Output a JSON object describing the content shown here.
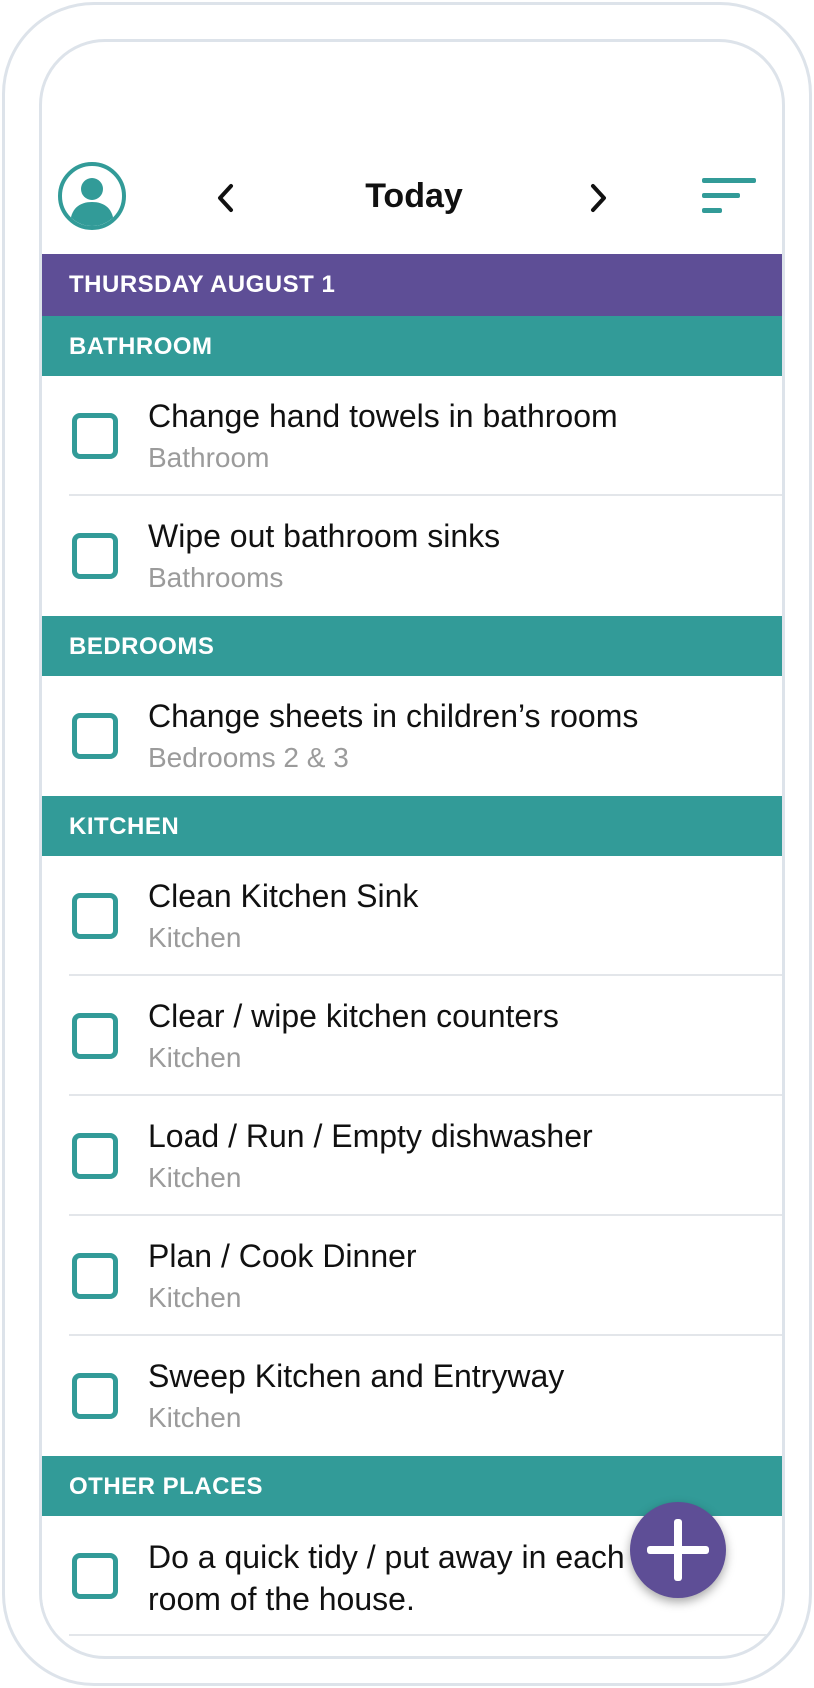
{
  "header": {
    "title": "Today",
    "prev_icon": "chevron-left-icon",
    "next_icon": "chevron-right-icon",
    "sort_icon": "sort-lines-icon",
    "avatar_icon": "user-avatar-icon"
  },
  "list": {
    "date": "THURSDAY AUGUST 1",
    "sections": [
      {
        "name": "BATHROOM",
        "tasks": [
          {
            "title": "Change hand towels in bathroom",
            "location": "Bathroom"
          },
          {
            "title": "Wipe out bathroom sinks",
            "location": "Bathrooms"
          }
        ]
      },
      {
        "name": "BEDROOMS",
        "tasks": [
          {
            "title": "Change sheets in children’s rooms",
            "location": "Bedrooms 2 & 3"
          }
        ]
      },
      {
        "name": "KITCHEN",
        "tasks": [
          {
            "title": "Clean Kitchen Sink",
            "location": "Kitchen"
          },
          {
            "title": "Clear / wipe kitchen counters",
            "location": "Kitchen"
          },
          {
            "title": "Load / Run / Empty dishwasher",
            "location": "Kitchen"
          },
          {
            "title": "Plan / Cook Dinner",
            "location": "Kitchen"
          },
          {
            "title": "Sweep Kitchen and Entryway",
            "location": "Kitchen"
          }
        ]
      },
      {
        "name": "OTHER PLACES",
        "tasks": [
          {
            "title": "Do a quick tidy / put away in each room of the house.",
            "location": ""
          }
        ]
      }
    ]
  },
  "fab": {
    "icon": "plus-icon"
  },
  "colors": {
    "accent": "#329b98",
    "date_header": "#5e4e96",
    "fab": "#5e4e96",
    "subtext": "#9b9b9b"
  }
}
